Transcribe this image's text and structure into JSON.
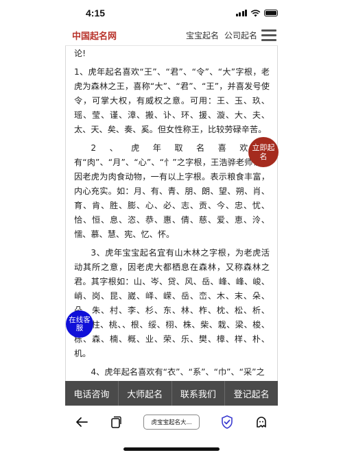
{
  "status": {
    "time": "4:15"
  },
  "header": {
    "logo": "中国起名网",
    "nav": [
      "宝宝起名",
      "公司起名"
    ]
  },
  "article": {
    "paragraphs": [
      "论!",
      "1、虎年起名喜欢“王”、“君”、“令”、“大”字根，老虎为森林之王，喜称“大”、“君”、“王”，并喜发号使令，可掌大权，有威权之意。可用：王、玉、玖、瑶、莹、谨、漳、搬、讣、环、援、漩、大、夫、太、天、矣、奏、奚。但女性称王，比较劳碌辛苦。",
      "2、虎年取名喜欢喜有“肉”、“月”、“心”、“忄”之字根，王浩骅老师认为因老虎为肉食动物，一有以上字根。表示粮食丰富，内心充实。如：月、有、青、朋、朗、望、朔、肖、育、肯、胜、膨、心、必、志、贡、今、忠、忧、恰、恒、息、恣、恭、惠、倩、慈、爱、恵、泠、懦、慕、慧、宪、忆、怀。",
      "3、虎年宝宝起名宜有山木林之字根，为老虎活动其所之意，因老虎大都栖息在森林，又称森林之君。其字根如：山、岑、贷、风、岳、峰、峰、峻、峭、岗、昆、崴、峄、嵘、岳、峦、木、末、朵、朵、朱、村、李、杉、东、林、柞、枕、松、析、柳、柱、桃、、根、绥、栩、株、柴、栽、梁、梭、栋、森、楠、概、业、荣、乐、樊、樟、样、朴、机。",
      "4、虎年起名喜欢有“衣”、“系”、“巾”、“采”之"
    ]
  },
  "floats": {
    "name_now": "立即起名",
    "online_service": "在线客服"
  },
  "actions": [
    "电话咨询",
    "大师起名",
    "联系我们",
    "登记起名"
  ],
  "browser": {
    "url_title": "虎宝宝起名大..."
  }
}
